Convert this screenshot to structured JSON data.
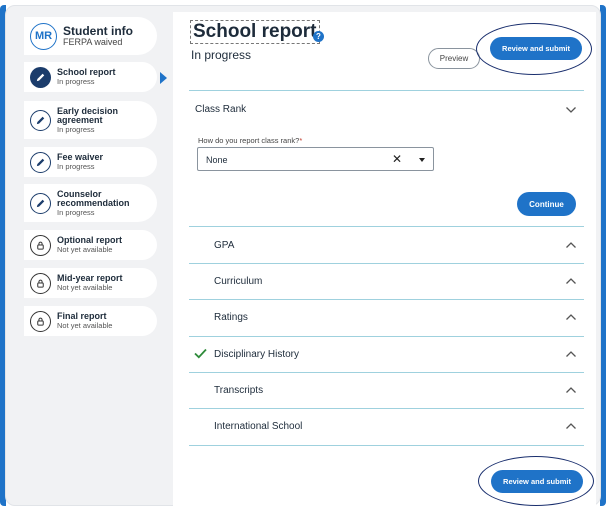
{
  "sidebar": {
    "student": {
      "initials": "MR",
      "title": "Student info",
      "sub": "FERPA waived"
    },
    "items": [
      {
        "title": "School report",
        "sub": "In progress",
        "icon": "pencil-icon"
      },
      {
        "title": "Early decision",
        "title2": "agreement",
        "sub": "In progress",
        "icon": "pencil-icon"
      },
      {
        "title": "Fee waiver",
        "sub": "In progress",
        "icon": "pencil-icon"
      },
      {
        "title": "Counselor",
        "title2": "recommendation",
        "sub": "In progress",
        "icon": "pencil-icon"
      },
      {
        "title": "Optional report",
        "sub": "Not yet available",
        "icon": "lock-icon"
      },
      {
        "title": "Mid-year report",
        "sub": "Not yet available",
        "icon": "lock-icon"
      },
      {
        "title": "Final report",
        "sub": "Not yet available",
        "icon": "lock-icon"
      }
    ]
  },
  "header": {
    "title": "School report",
    "status": "In progress",
    "preview_label": "Preview",
    "submit_label": "Review and submit"
  },
  "class_rank": {
    "title": "Class Rank",
    "question": "How do you report class rank?",
    "required_mark": "*",
    "selected": "None",
    "clear_glyph": "✕",
    "continue_label": "Continue"
  },
  "sections": [
    {
      "label": "GPA",
      "completed": false
    },
    {
      "label": "Curriculum",
      "completed": false
    },
    {
      "label": "Ratings",
      "completed": false
    },
    {
      "label": "Disciplinary History",
      "completed": true
    },
    {
      "label": "Transcripts",
      "completed": false
    },
    {
      "label": "International School",
      "completed": false
    }
  ],
  "footer": {
    "submit_label": "Review and submit"
  },
  "colors": {
    "accent": "#1f73c8",
    "navy": "#1b3c6b",
    "divider": "#9fd1de",
    "check": "#2e8b3a"
  }
}
